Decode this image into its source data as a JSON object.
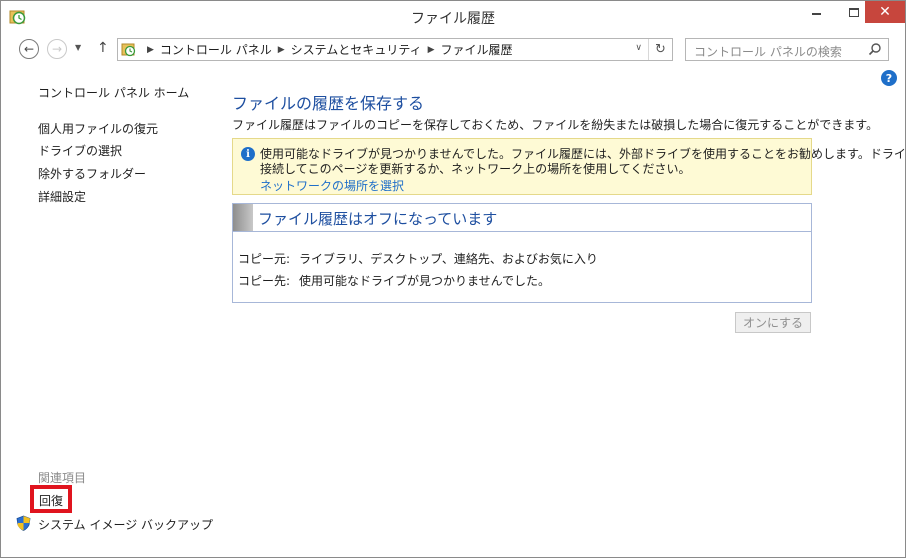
{
  "window": {
    "title": "ファイル履歴",
    "close_glyph": "✕"
  },
  "navigation": {
    "back_glyph": "←",
    "forward_glyph": "→",
    "recent_glyph": "▼",
    "up_glyph": "↑",
    "breadcrumbs": [
      "コントロール パネル",
      "システムとセキュリティ",
      "ファイル履歴"
    ],
    "refresh_glyph": "↻",
    "dropdown_glyph": "∨",
    "search_placeholder": "コントロール パネルの検索"
  },
  "help": {
    "glyph": "?"
  },
  "sidebar": {
    "home": "コントロール パネル ホーム",
    "items": [
      "個人用ファイルの復元",
      "ドライブの選択",
      "除外するフォルダー",
      "詳細設定"
    ],
    "related_heading": "関連項目",
    "related_items": [
      "回復",
      "システム イメージ バックアップ"
    ]
  },
  "main": {
    "title": "ファイルの履歴を保存する",
    "description": "ファイル履歴はファイルのコピーを保存しておくため、ファイルを紛失または破損した場合に復元することができます。",
    "info": {
      "glyph": "i",
      "line1": "使用可能なドライブが見つかりませんでした。ファイル履歴には、外部ドライブを使用することをお勧めします。ドライブを",
      "line2": "接続してこのページを更新するか、ネットワーク上の場所を使用してください。",
      "link": "ネットワークの場所を選択"
    },
    "status": {
      "title": "ファイル履歴はオフになっています",
      "rows": [
        {
          "label": "コピー元:",
          "value": "ライブラリ、デスクトップ、連絡先、およびお気に入り"
        },
        {
          "label": "コピー先:",
          "value": "使用可能なドライブが見つかりませんでした。"
        }
      ]
    },
    "turn_on_label": "オンにする"
  },
  "colors": {
    "accent": "#1e4fa0",
    "link": "#1f6fc9",
    "highlight": "#e0141e",
    "close_button": "#c7463d",
    "info_background": "#fefad5"
  }
}
